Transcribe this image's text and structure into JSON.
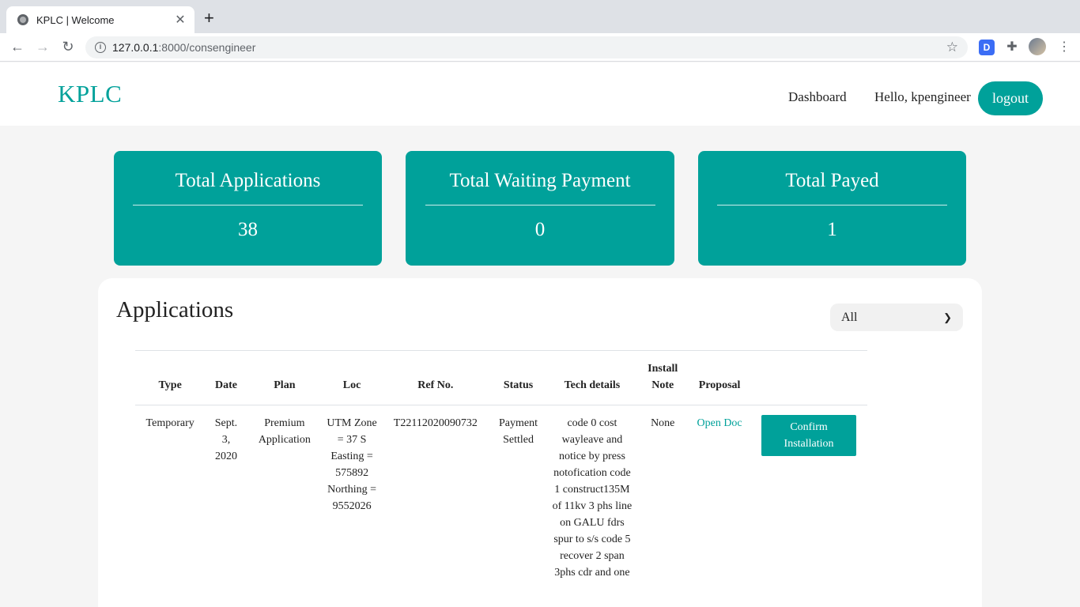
{
  "browser": {
    "tab_title": "KPLC | Welcome",
    "url_host": "127.0.0.1",
    "url_path": ":8000/consengineer",
    "ext_d_label": "D"
  },
  "header": {
    "logo": "KPLC",
    "nav_dashboard": "Dashboard",
    "greeting": "Hello, kpengineer",
    "logout_label": "logout"
  },
  "stats": [
    {
      "title": "Total Applications",
      "value": "38"
    },
    {
      "title": "Total Waiting Payment",
      "value": "0"
    },
    {
      "title": "Total Payed",
      "value": "1"
    }
  ],
  "applications": {
    "title": "Applications",
    "filter_value": "All",
    "columns": [
      "Type",
      "Date",
      "Plan",
      "Loc",
      "Ref No.",
      "Status",
      "Tech details",
      "Install Note",
      "Proposal",
      ""
    ],
    "rows": [
      {
        "type": "Temporary",
        "date": "Sept. 3, 2020",
        "plan": "Premium Application",
        "loc": "UTM Zone = 37 S Easting = 575892 Northing = 9552026",
        "ref_no": "T22112020090732",
        "status": "Payment Settled",
        "tech_details": "code 0 cost wayleave and notice by press notofication code 1 construct135M of 11kv 3 phs line on GALU fdrs spur to s/s code 5 recover 2 span 3phs cdr and one",
        "install_note": "None",
        "proposal_link": "Open Doc",
        "action_label": "Confirm Installation"
      }
    ]
  },
  "colors": {
    "brand": "#00a19a",
    "page_bg": "#f5f5f5"
  }
}
